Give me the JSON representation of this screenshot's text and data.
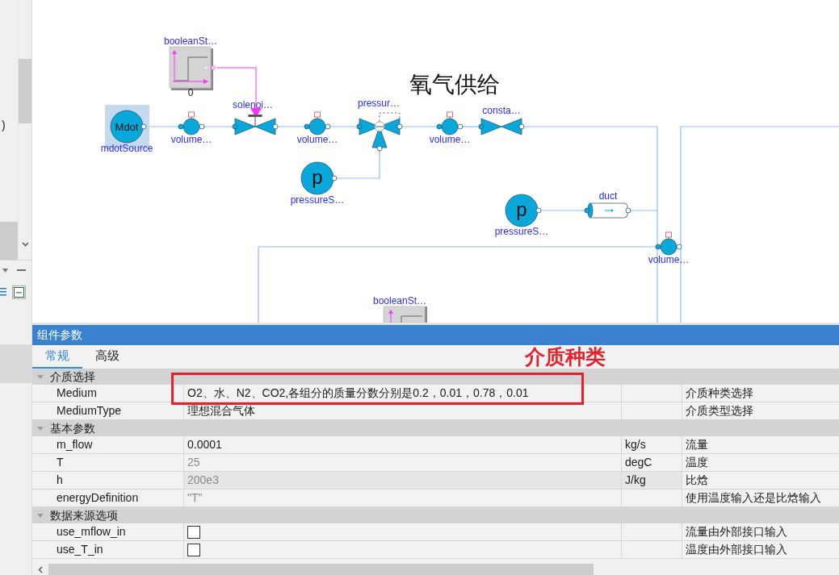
{
  "sidebar": {
    "visible_text": ")"
  },
  "diagram": {
    "title": "氧气供给",
    "components": [
      {
        "kind": "step_source",
        "label": "booleanSt…",
        "value_label": "0",
        "selected": false
      },
      {
        "kind": "flow_source",
        "label": "mdotSource",
        "symbol": "Mdot",
        "selected": true
      },
      {
        "kind": "volume",
        "label": "volume…",
        "selected": false
      },
      {
        "kind": "solenoid_valve",
        "label": "solenoi…",
        "selected": false
      },
      {
        "kind": "volume",
        "label": "volume…",
        "selected": false
      },
      {
        "kind": "pressure_valve",
        "label": "pressur…",
        "selected": false
      },
      {
        "kind": "pressure_source",
        "label": "pressureS…",
        "symbol": "p",
        "selected": false
      },
      {
        "kind": "volume",
        "label": "volume…",
        "selected": false
      },
      {
        "kind": "valve",
        "label": "consta…",
        "selected": false
      },
      {
        "kind": "pressure_source",
        "label": "pressureS…",
        "symbol": "p",
        "selected": false
      },
      {
        "kind": "duct",
        "label": "duct",
        "selected": false
      },
      {
        "kind": "volume",
        "label": "volume…",
        "selected": false
      },
      {
        "kind": "step_source",
        "label": "booleanSt…",
        "selected": false
      }
    ]
  },
  "parameters_panel": {
    "title": "组件参数",
    "tabs": [
      {
        "label": "常规",
        "selected": true
      },
      {
        "label": "高级",
        "selected": false
      }
    ],
    "annotation": {
      "text": "介质种类"
    },
    "groups": [
      {
        "title": "介质选择",
        "expanded": true,
        "rows": [
          {
            "kind": "text",
            "name": "Medium",
            "value": "O2、水、N2、CO2,各组分的质量分数分别是0.2，0.01，0.78，0.01",
            "description": "介质种类选择",
            "disabled": false,
            "selected": false
          },
          {
            "kind": "text",
            "name": "MediumType",
            "value": "理想混合气体",
            "description": "介质类型选择",
            "disabled": false,
            "selected": false
          }
        ]
      },
      {
        "title": "基本参数",
        "expanded": true,
        "rows": [
          {
            "kind": "text",
            "name": "m_flow",
            "value": "0.0001",
            "unit": "kg/s",
            "description": "流量",
            "disabled": false,
            "selected": false
          },
          {
            "kind": "text",
            "name": "T",
            "value": "25",
            "unit": "degC",
            "description": "温度",
            "disabled": true,
            "selected": false
          },
          {
            "kind": "text",
            "name": "h",
            "value": "200e3",
            "unit": "J/kg",
            "description": "比焓",
            "disabled": true,
            "selected": true
          },
          {
            "kind": "text",
            "name": "energyDefinition",
            "value": "\"T\"",
            "description": "使用温度输入还是比焓输入",
            "disabled": true,
            "selected": false
          }
        ]
      },
      {
        "title": "数据来源选项",
        "expanded": true,
        "rows": [
          {
            "kind": "checkbox",
            "name": "use_mflow_in",
            "checked": false,
            "description": "流量由外部接口输入",
            "selected": false
          },
          {
            "kind": "checkbox",
            "name": "use_T_in",
            "checked": false,
            "description": "温度由外部接口输入",
            "selected": false
          }
        ]
      }
    ]
  }
}
